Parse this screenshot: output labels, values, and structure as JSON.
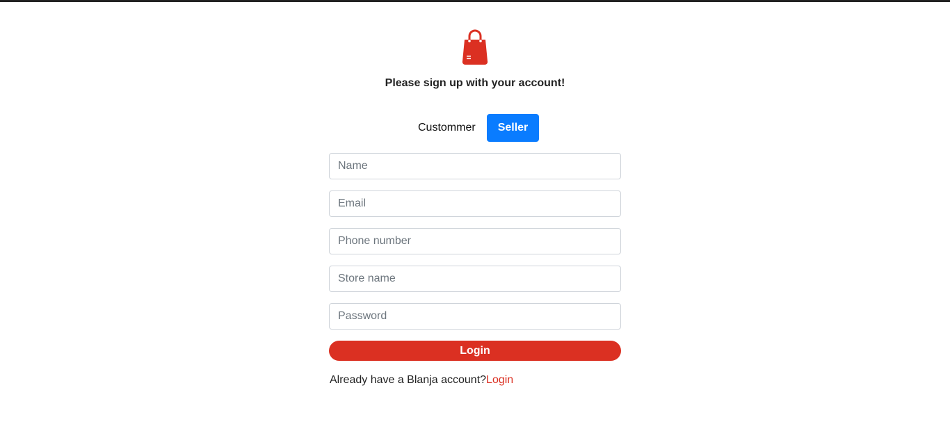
{
  "header": {
    "subtitle": "Please sign up with your account!",
    "logo_icon": "shopping-bag-icon",
    "brand_color": "#db3022"
  },
  "role_toggle": {
    "customer_label": "Custommer",
    "seller_label": "Seller",
    "selected": "Seller",
    "active_color": "#0a7cff"
  },
  "form": {
    "name_placeholder": "Name",
    "email_placeholder": "Email",
    "phone_placeholder": "Phone number",
    "store_placeholder": "Store name",
    "password_placeholder": "Password",
    "submit_label": "Login"
  },
  "footer": {
    "prompt": "Already have a Blanja account?",
    "link_label": "Login"
  }
}
